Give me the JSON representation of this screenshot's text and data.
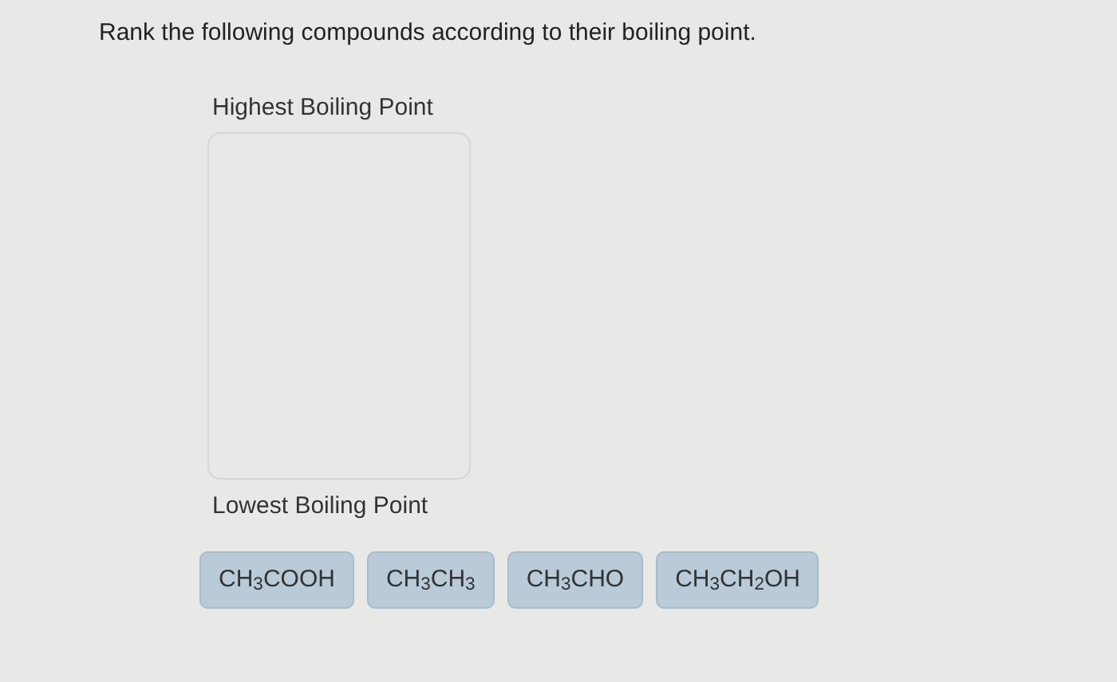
{
  "question": "Rank the following compounds according to their boiling point.",
  "ranking": {
    "top_label": "Highest Boiling Point",
    "bottom_label": "Lowest Boiling Point"
  },
  "choices": [
    "CH$_{3}$COOH",
    "CH$_{3}$CH$_{3}$",
    "CH$_{3}$CHO",
    "CH$_{3}$CH$_{2}$OH"
  ]
}
